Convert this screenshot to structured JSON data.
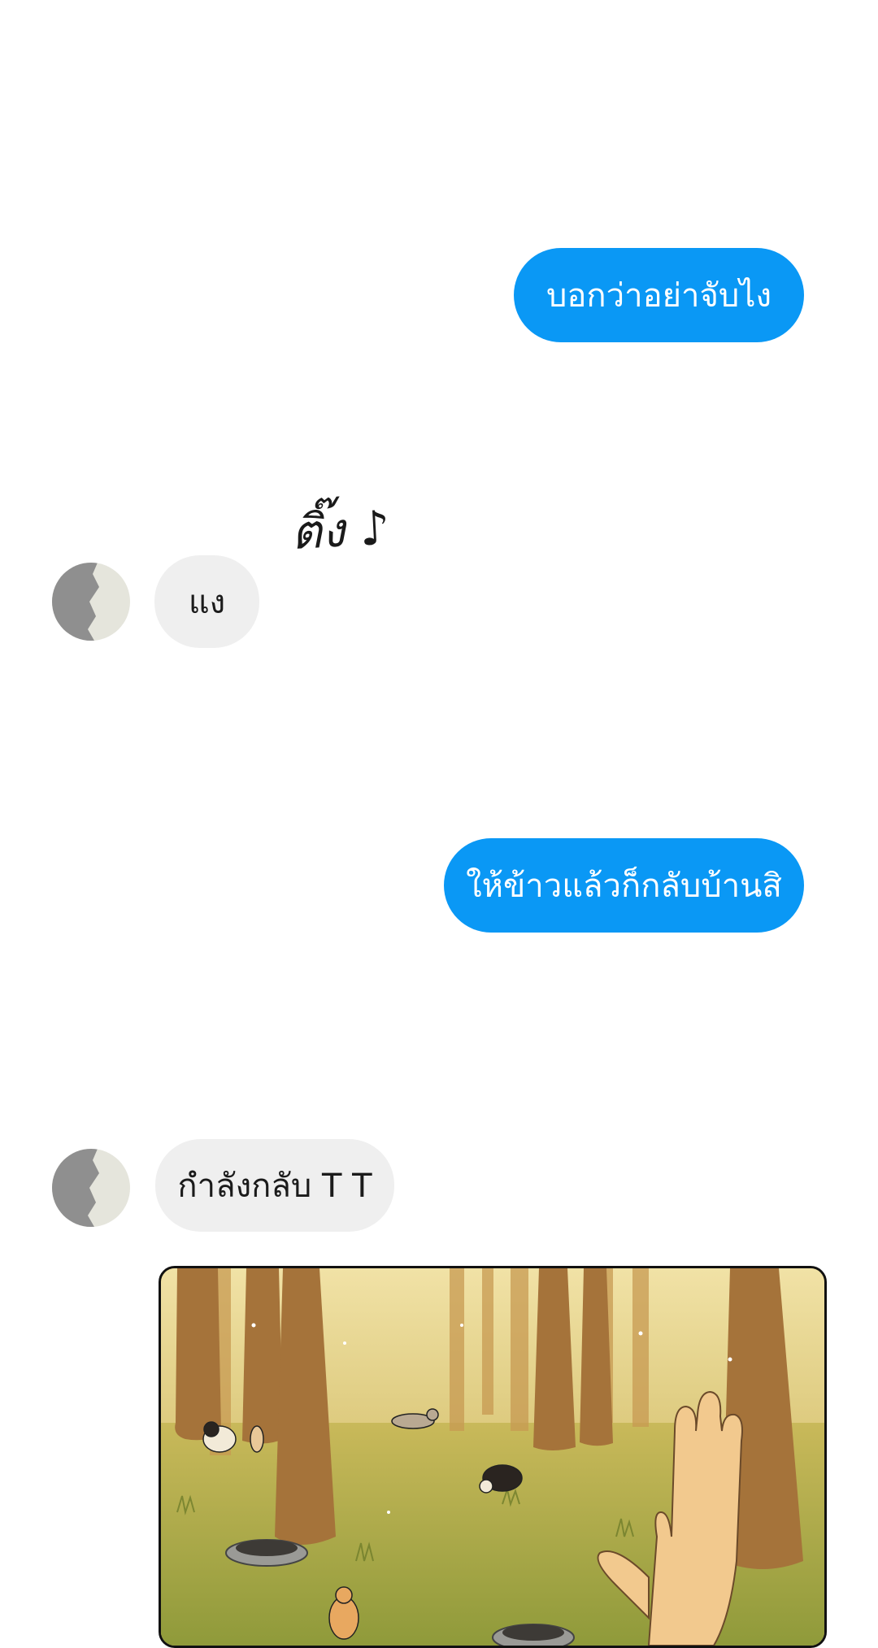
{
  "messages": [
    {
      "direction": "outgoing",
      "text": "บอกว่าอย่าจับไง"
    },
    {
      "direction": "incoming",
      "text": "แง"
    },
    {
      "direction": "outgoing",
      "text": "ให้ข้าวแล้วก็กลับบ้านสิ"
    },
    {
      "direction": "incoming",
      "text": "กำลังกลับ T T"
    }
  ],
  "sound_effect": "ติ๊ง ♪",
  "colors": {
    "outgoing_bubble": "#0a98f5",
    "incoming_bubble": "#efefef",
    "background": "#ffffff"
  },
  "attachment": {
    "type": "illustration",
    "subject": "cats-in-forest-with-food-bowls"
  }
}
